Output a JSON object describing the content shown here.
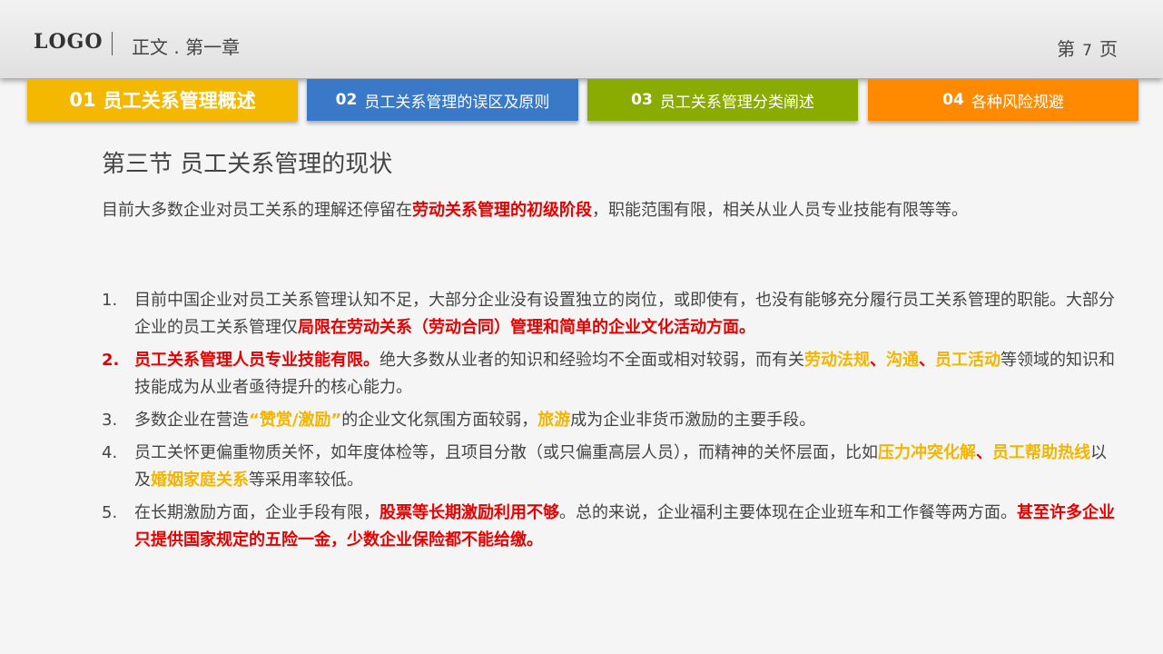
{
  "header": {
    "logo": "LOGO",
    "title": "正文 . 第一章",
    "page_prefix": "第",
    "page_number": "7",
    "page_suffix": "页"
  },
  "tabs": [
    {
      "num": "01",
      "label": "员工关系管理概述",
      "color": "#f5b800"
    },
    {
      "num": "02",
      "label": "员工关系管理的误区及原则",
      "color": "#3a78c8"
    },
    {
      "num": "03",
      "label": "员工关系管理分类阐述",
      "color": "#8aac00"
    },
    {
      "num": "04",
      "label": "各种风险规避",
      "color": "#ff8a00"
    }
  ],
  "section_title": "第三节  员工关系管理的现状",
  "intro": {
    "t1": "目前大多数企业对员工关系的理解还停留在",
    "h1": "劳动关系管理的初级阶段",
    "t2": "，职能范围有限，相关从业人员专业技能有限等等。"
  },
  "items": [
    {
      "idx": "1.",
      "t1": "目前中国企业对员工关系管理认知不足，大部分企业没有设置独立的岗位，或即使有，也没有能够充分履行员工关系管理的职能。大部分企业的员工关系管理仅",
      "h1": "局限在劳动关系（劳动合同）管理和简单的企业文化活动方面。"
    },
    {
      "idx": "2.",
      "h1": "员工关系管理人员专业技能有限。",
      "t1": "绝大多数从业者的知识和经验均不全面或相对较弱，而有关",
      "g1": "劳动法规",
      "s1": "、",
      "g2": "沟通",
      "s2": "、",
      "g3": "员工活动",
      "t2": "等领域的知识和技能成为从业者亟待提升的核心能力。"
    },
    {
      "idx": "3.",
      "t1": "多数企业在营造",
      "g1": "“赞赏/激励”",
      "t2": "的企业文化氛围方面较弱，",
      "g2": "旅游",
      "t3": "成为企业非货币激励的主要手段。"
    },
    {
      "idx": "4.",
      "t1": "员工关怀更偏重物质关怀，如年度体检等，且项目分散（或只偏重高层人员），而精神的关怀层面，比如",
      "g1": "压力冲突化解",
      "s1": "、",
      "g2": "员工帮助热线",
      "t2": "以及",
      "g3": "婚姻家庭关系",
      "t3": "等采用率较低。"
    },
    {
      "idx": "5.",
      "t1": "在长期激励方面，企业手段有限，",
      "h1": "股票等长期激励利用不够",
      "t2": "。总的来说，企业福利主要体现在企业班车和工作餐等两方面。",
      "h2": "甚至许多企业只提供国家规定的五险一金，少数企业保险都不能给缴。"
    }
  ],
  "colors": {
    "highlight_red": "#e60000",
    "highlight_gold": "#f4b400"
  }
}
